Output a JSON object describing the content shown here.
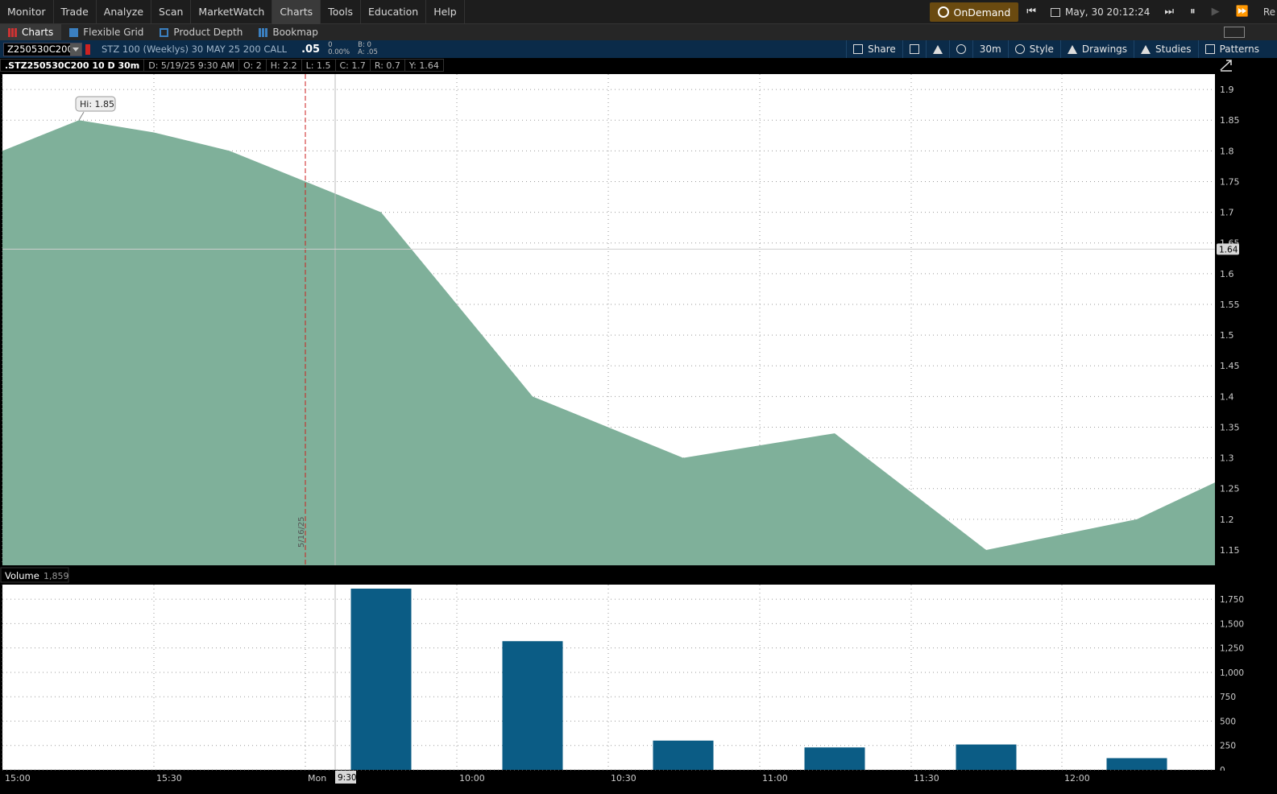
{
  "menu": {
    "items": [
      "Monitor",
      "Trade",
      "Analyze",
      "Scan",
      "MarketWatch",
      "Charts",
      "Tools",
      "Education",
      "Help"
    ],
    "active_index": 5
  },
  "topbar": {
    "ondemand_label": "OnDemand",
    "datetime": "May, 30 20:12:24",
    "right_partial": "Re"
  },
  "subtabs": {
    "charts": "Charts",
    "flexible_grid": "Flexible Grid",
    "product_depth": "Product Depth",
    "bookmap": "Bookmap"
  },
  "symbol": {
    "input": "Z250530C200",
    "description": "STZ 100 (Weeklys) 30 MAY 25 200 CALL",
    "last": ".05",
    "change_line1": "0",
    "change_line2": "0.00%",
    "bid": "B: 0",
    "ask": "A: .05"
  },
  "toolbar": {
    "share": "Share",
    "timeframe": "30m",
    "style": "Style",
    "drawings": "Drawings",
    "studies": "Studies",
    "patterns": "Patterns"
  },
  "infobar": {
    "symbol": ".STZ250530C200 10 D 30m",
    "date": "D: 5/19/25 9:30 AM",
    "open": "O: 2",
    "high": "H: 2.2",
    "low": "L: 1.5",
    "close": "C: 1.7",
    "range": "R: 0.7",
    "y": "Y: 1.64"
  },
  "volume_header": {
    "label": "Volume",
    "value": "1,859"
  },
  "colors": {
    "area_fill": "#7fb09a",
    "volume_bar": "#0b5c85",
    "grid": "#9a9a9a",
    "date_divider": "#cc1f1f"
  },
  "chart_data": [
    {
      "type": "area",
      "series": [
        {
          "name": ".STZ250530C200",
          "x": [
            "15:00",
            "15:15",
            "15:30",
            "15:45",
            "9:30",
            "10:00",
            "10:30",
            "11:00",
            "11:30",
            "12:00",
            "12:30"
          ],
          "values": [
            1.8,
            1.85,
            1.83,
            1.8,
            1.7,
            1.4,
            1.3,
            1.34,
            1.15,
            1.2,
            1.26
          ]
        }
      ],
      "ylim": [
        1.125,
        1.925
      ],
      "yticks": [
        "1.15",
        "1.2",
        "1.25",
        "1.3",
        "1.35",
        "1.4",
        "1.45",
        "1.5",
        "1.55",
        "1.6",
        "1.65",
        "1.7",
        "1.75",
        "1.8",
        "1.85",
        "1.9"
      ],
      "xticks": [
        "15:00",
        "15:30",
        "Mon",
        "9:30",
        "10:00",
        "10:30",
        "11:00",
        "11:30",
        "12:00"
      ],
      "annotations": {
        "high": "Hi: 1.85",
        "crosshair_value": "1.64",
        "date_divider": "5/16/25"
      },
      "crosshair_y": 1.64,
      "grid": true
    },
    {
      "type": "bar",
      "title": "Volume",
      "categories": [
        "9:30",
        "10:00",
        "10:30",
        "11:00",
        "11:30",
        "12:00"
      ],
      "values": [
        1859,
        1320,
        300,
        230,
        260,
        120
      ],
      "yticks": [
        "0",
        "250",
        "500",
        "750",
        "1,000",
        "1,250",
        "1,500",
        "1,750"
      ],
      "ylim": [
        0,
        1900
      ],
      "grid": true
    }
  ]
}
